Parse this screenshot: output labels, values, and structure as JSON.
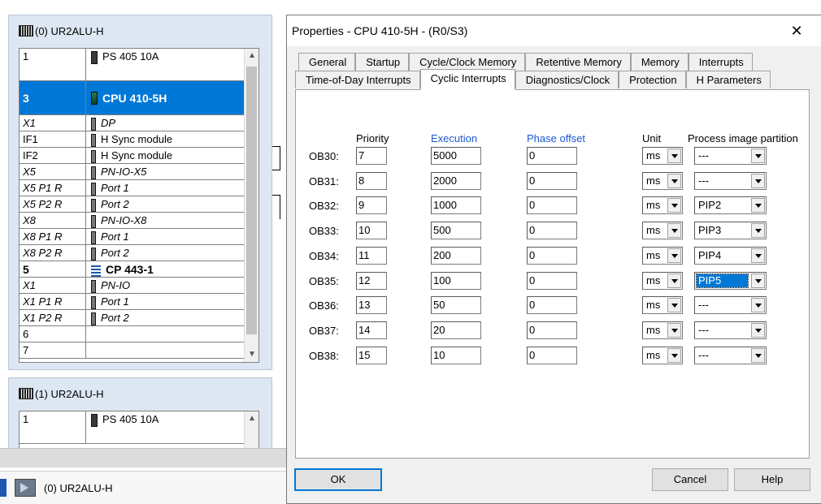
{
  "rack0": {
    "title": "(0) UR2ALU-H",
    "rows": [
      {
        "slot": "1",
        "module": "PS 405 10A"
      },
      {
        "slot": "3",
        "module": "CPU 410-5H"
      },
      {
        "slot": "X1",
        "module": "DP"
      },
      {
        "slot": "IF1",
        "module": "H Sync module"
      },
      {
        "slot": "IF2",
        "module": "H Sync module"
      },
      {
        "slot": "X5",
        "module": "PN-IO-X5"
      },
      {
        "slot": "X5 P1 R",
        "module": "Port 1"
      },
      {
        "slot": "X5 P2 R",
        "module": "Port 2"
      },
      {
        "slot": "X8",
        "module": "PN-IO-X8"
      },
      {
        "slot": "X8 P1 R",
        "module": "Port 1"
      },
      {
        "slot": "X8 P2 R",
        "module": "Port 2"
      },
      {
        "slot": "5",
        "module": "CP 443-1"
      },
      {
        "slot": "X1",
        "module": "PN-IO"
      },
      {
        "slot": "X1 P1 R",
        "module": "Port 1"
      },
      {
        "slot": "X1 P2 R",
        "module": "Port 2"
      },
      {
        "slot": "6",
        "module": ""
      },
      {
        "slot": "7",
        "module": ""
      }
    ]
  },
  "rack1": {
    "title": "(1) UR2ALU-H",
    "rows": [
      {
        "slot": "1",
        "module": "PS 405 10A"
      }
    ]
  },
  "status": {
    "label": "(0)   UR2ALU-H"
  },
  "dialog": {
    "title": "Properties - CPU 410-5H - (R0/S3)",
    "close_glyph": "✕",
    "tabs_row1": [
      "General",
      "Startup",
      "Cycle/Clock Memory",
      "Retentive Memory",
      "Memory",
      "Interrupts"
    ],
    "tabs_row2": [
      "Time-of-Day Interrupts",
      "Cyclic Interrupts",
      "Diagnostics/Clock",
      "Protection",
      "H Parameters"
    ],
    "active_tab": "Cyclic Interrupts",
    "headers": {
      "priority": "Priority",
      "execution": "Execution",
      "phase_offset": "Phase offset",
      "unit": "Unit",
      "pip": "Process image partition"
    },
    "rows": [
      {
        "ob": "OB30:",
        "priority": "7",
        "execution": "5000",
        "phase": "0",
        "unit": "ms",
        "pip": "---"
      },
      {
        "ob": "OB31:",
        "priority": "8",
        "execution": "2000",
        "phase": "0",
        "unit": "ms",
        "pip": "---"
      },
      {
        "ob": "OB32:",
        "priority": "9",
        "execution": "1000",
        "phase": "0",
        "unit": "ms",
        "pip": "PIP2"
      },
      {
        "ob": "OB33:",
        "priority": "10",
        "execution": "500",
        "phase": "0",
        "unit": "ms",
        "pip": "PIP3"
      },
      {
        "ob": "OB34:",
        "priority": "11",
        "execution": "200",
        "phase": "0",
        "unit": "ms",
        "pip": "PIP4"
      },
      {
        "ob": "OB35:",
        "priority": "12",
        "execution": "100",
        "phase": "0",
        "unit": "ms",
        "pip": "PIP5"
      },
      {
        "ob": "OB36:",
        "priority": "13",
        "execution": "50",
        "phase": "0",
        "unit": "ms",
        "pip": "---"
      },
      {
        "ob": "OB37:",
        "priority": "14",
        "execution": "20",
        "phase": "0",
        "unit": "ms",
        "pip": "---"
      },
      {
        "ob": "OB38:",
        "priority": "15",
        "execution": "10",
        "phase": "0",
        "unit": "ms",
        "pip": "---"
      }
    ],
    "buttons": {
      "ok": "OK",
      "cancel": "Cancel",
      "help": "Help"
    }
  }
}
